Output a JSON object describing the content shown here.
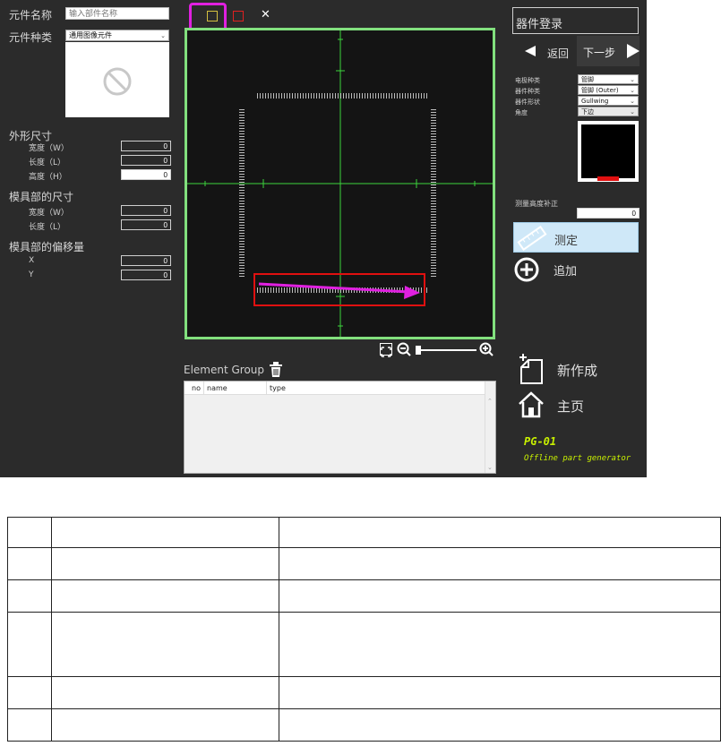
{
  "left": {
    "part_name_label": "元件名称",
    "part_name_placeholder": "输入部件名称",
    "part_type_label": "元件种类",
    "part_type_value": "通用图像元件",
    "outline_title": "外形尺寸",
    "width_label": "宽度（W）",
    "length_label": "长度（L）",
    "height_label": "高度（H）",
    "width_value": "0",
    "length_value": "0",
    "height_value": "0",
    "mold_title": "模具部的尺寸",
    "mold_width_label": "宽度（W）",
    "mold_length_label": "长度（L）",
    "mold_width_value": "0",
    "mold_length_value": "0",
    "offset_title": "模具部的偏移量",
    "x_label": "X",
    "y_label": "Y",
    "x_value": "0",
    "y_value": "0"
  },
  "toolbar": {
    "close_glyph": "✕"
  },
  "element_group": {
    "title": "Element Group",
    "columns": [
      "no",
      "name",
      "type"
    ]
  },
  "right": {
    "register_title": "器件登录",
    "back_label": "返回",
    "next_label": "下一步",
    "lead_type_label": "电极种类",
    "lead_type_value": "管脚",
    "part_kind_label": "器件种类",
    "part_kind_value": "管脚 (Outer)",
    "shape_label": "器件形状",
    "shape_value": "Gullwing",
    "angle_label": "角度",
    "angle_value": "下边",
    "height_comp_label": "测量高度补正",
    "height_comp_value": "0",
    "measure_label": "测定",
    "add_label": "追加",
    "new_label": "新作成",
    "home_label": "主页",
    "app_code": "PG-01",
    "app_desc": "Offline part generator"
  },
  "colors": {
    "viewer_border": "#82e07e",
    "highlight_magenta": "#e020e0",
    "select_red": "#e01010",
    "crosshair_green": "#3cd43c",
    "brand_yellow": "#c8f000"
  }
}
